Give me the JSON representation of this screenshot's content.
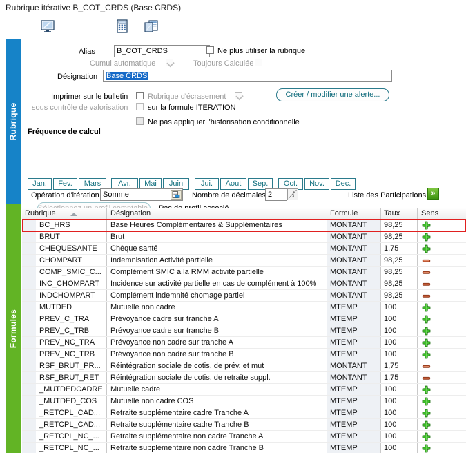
{
  "window": {
    "title": "Rubrique itérative B_COT_CRDS (Base CRDS)"
  },
  "toolbar": {
    "buttons": [
      {
        "name": "monitor-icon",
        "tooltip": "Aperçu"
      },
      {
        "name": "calculator-icon",
        "tooltip": "Calculatrice"
      },
      {
        "name": "cascade-windows-icon",
        "tooltip": "Fenêtres"
      }
    ]
  },
  "side_tabs": [
    {
      "label": "Rubrique",
      "color": "#1683c8"
    },
    {
      "label": "Formules",
      "color": "#62b425"
    }
  ],
  "form": {
    "alias_label": "Alias",
    "alias_value": "B_COT_CRDS",
    "cumul_label": "Cumul automatique",
    "cumul_checked": true,
    "toujours_calculee_label": "Toujours Calculée",
    "toujours_calculee_checked": false,
    "ne_plus_utiliser_label": "Ne plus utiliser la rubrique",
    "ne_plus_utiliser_checked": false,
    "designation_label": "Désignation",
    "designation_value": "Base CRDS",
    "imprimer_label": "Imprimer sur le bulletin",
    "sous_controle_label": "sous contrôle de valorisation",
    "rubrique_ecrasement_label": "Rubrique d'écrasement",
    "rubrique_ecrasement_checked": false,
    "ecrasement_side_checked": true,
    "formule_iteration_label": "sur la formule ITERATION",
    "formule_iteration_checked": false,
    "historisation_label": "Ne pas appliquer l'historisation conditionnelle",
    "historisation_checked": false,
    "alerte_button": "Créer / modifier une alerte..."
  },
  "frequence": {
    "title": "Fréquence de calcul",
    "months": [
      "Jan.",
      "Fev.",
      "Mars",
      "Avr.",
      "Mai",
      "Juin",
      "Jui.",
      "Aout",
      "Sep.",
      "Oct.",
      "Nov.",
      "Dec."
    ]
  },
  "profil": {
    "select_button": "Sélectionnez un profil comptable...",
    "status": "Pas de profil associé."
  },
  "iteration": {
    "operation_label": "Opération d'itération",
    "operation_value": "Somme",
    "decimales_label": "Nombre de décimales",
    "decimales_value": "2",
    "participations_label": "Liste des Participations",
    "participations_icon": "»"
  },
  "grid": {
    "columns": [
      "Rubrique",
      "Désignation",
      "Formule",
      "Taux",
      "Sens"
    ],
    "sort_column": "Rubrique",
    "sort_direction": "asc",
    "highlighted_row_index": 0,
    "rows": [
      {
        "rubrique": "BC_HRS",
        "designation": "Base Heures Complémentaires & Supplémentaires",
        "formule": "MONTANT",
        "taux": "98,25",
        "sens": "plus"
      },
      {
        "rubrique": "BRUT",
        "designation": "Brut",
        "formule": "MONTANT",
        "taux": "98,25",
        "sens": "plus"
      },
      {
        "rubrique": "CHEQUESANTE",
        "designation": "Chèque santé",
        "formule": "MONTANT",
        "taux": "1.75",
        "sens": "plus"
      },
      {
        "rubrique": "CHOMPART",
        "designation": "Indemnisation Activité partielle",
        "formule": "MONTANT",
        "taux": "98,25",
        "sens": "minus"
      },
      {
        "rubrique": "COMP_SMIC_C...",
        "designation": "Complément SMIC à la RMM activité partielle",
        "formule": "MONTANT",
        "taux": "98,25",
        "sens": "minus"
      },
      {
        "rubrique": "INC_CHOMPART",
        "designation": "Incidence sur activité partielle en cas de complément à 100%",
        "formule": "MONTANT",
        "taux": "98,25",
        "sens": "minus"
      },
      {
        "rubrique": "INDCHOMPART",
        "designation": "Complément indemnité chomage partiel",
        "formule": "MONTANT",
        "taux": "98,25",
        "sens": "minus"
      },
      {
        "rubrique": "MUTDED",
        "designation": "Mutuelle non cadre",
        "formule": "MTEMP",
        "taux": "100",
        "sens": "plus"
      },
      {
        "rubrique": "PREV_C_TRA",
        "designation": "Prévoyance cadre sur tranche A",
        "formule": "MTEMP",
        "taux": "100",
        "sens": "plus"
      },
      {
        "rubrique": "PREV_C_TRB",
        "designation": "Prévoyance cadre sur tranche B",
        "formule": "MTEMP",
        "taux": "100",
        "sens": "plus"
      },
      {
        "rubrique": "PREV_NC_TRA",
        "designation": "Prévoyance non cadre sur tranche A",
        "formule": "MTEMP",
        "taux": "100",
        "sens": "plus"
      },
      {
        "rubrique": "PREV_NC_TRB",
        "designation": "Prévoyance non cadre sur tranche B",
        "formule": "MTEMP",
        "taux": "100",
        "sens": "plus"
      },
      {
        "rubrique": "RSF_BRUT_PR...",
        "designation": "Réintégration sociale de cotis. de prév. et mut",
        "formule": "MONTANT",
        "taux": "1,75",
        "sens": "minus"
      },
      {
        "rubrique": "RSF_BRUT_RET",
        "designation": "Réintégration sociale de cotis. de retraite suppl.",
        "formule": "MONTANT",
        "taux": "1,75",
        "sens": "minus"
      },
      {
        "rubrique": "_MUTDEDCADRE",
        "designation": "Mutuelle cadre",
        "formule": "MTEMP",
        "taux": "100",
        "sens": "plus"
      },
      {
        "rubrique": "_MUTDED_COS",
        "designation": "Mutuelle non cadre COS",
        "formule": "MTEMP",
        "taux": "100",
        "sens": "plus"
      },
      {
        "rubrique": "_RETCPL_CAD...",
        "designation": "Retraite supplémentaire cadre Tranche A",
        "formule": "MTEMP",
        "taux": "100",
        "sens": "plus"
      },
      {
        "rubrique": "_RETCPL_CAD...",
        "designation": "Retraite supplémentaire cadre Tranche B",
        "formule": "MTEMP",
        "taux": "100",
        "sens": "plus"
      },
      {
        "rubrique": "_RETCPL_NC_...",
        "designation": "Retraite supplémentaire non cadre Tranche A",
        "formule": "MTEMP",
        "taux": "100",
        "sens": "plus"
      },
      {
        "rubrique": "_RETCPL_NC_...",
        "designation": "Retraite supplémentaire non cadre Tranche B",
        "formule": "MTEMP",
        "taux": "100",
        "sens": "plus"
      }
    ]
  },
  "colors": {
    "tab_blue": "#1683c8",
    "tab_green": "#62b425",
    "accent_teal": "#12707f",
    "highlight_red": "#e02020",
    "selection_blue": "#1569c7",
    "plus_green": "#2f9e1e",
    "minus_red": "#b5442b"
  }
}
